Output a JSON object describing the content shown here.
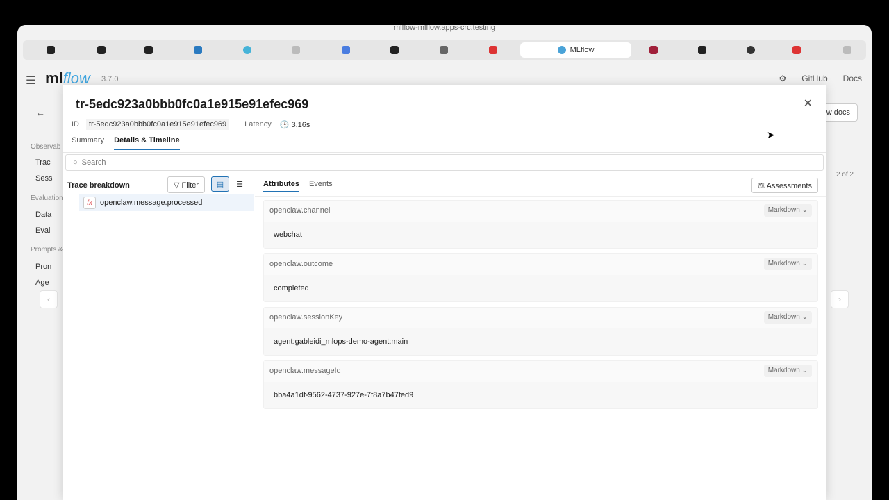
{
  "browser": {
    "url": "mlflow-mlflow.apps-crc.testing",
    "active_tab_title": "MLflow"
  },
  "app": {
    "logo_text": "ml",
    "logo_italic": "flow",
    "version": "3.7.0",
    "header_links": [
      "GitHub",
      "Docs"
    ],
    "sidebar": {
      "sections": [
        "Observab",
        "Evaluation",
        "Prompts &"
      ],
      "items": [
        "Trac",
        "Sess",
        "Data",
        "Eval",
        "Pron",
        "Age"
      ]
    },
    "view_docs_label": "w docs",
    "pagination": "2 of 2"
  },
  "modal": {
    "title": "tr-5edc923a0bbb0fc0a1e915e91efec969",
    "id_label": "ID",
    "id_value": "tr-5edc923a0bbb0fc0a1e915e91efec969",
    "latency_label": "Latency",
    "latency_value": "3.16s",
    "tabs": [
      "Summary",
      "Details & Timeline"
    ],
    "search_placeholder": "Search",
    "trace_breakdown_label": "Trace breakdown",
    "filter_label": "Filter",
    "span_name": "openclaw.message.processed",
    "right_tabs": [
      "Attributes",
      "Events"
    ],
    "assessments_label": "Assessments",
    "attributes": [
      {
        "key": "openclaw.channel",
        "format": "Markdown",
        "value": "webchat"
      },
      {
        "key": "openclaw.outcome",
        "format": "Markdown",
        "value": "completed"
      },
      {
        "key": "openclaw.sessionKey",
        "format": "Markdown",
        "value": "agent:gableidi_mlops-demo-agent:main"
      },
      {
        "key": "openclaw.messageId",
        "format": "Markdown",
        "value": "bba4a1df-9562-4737-927e-7f8a7b47fed9"
      }
    ]
  }
}
